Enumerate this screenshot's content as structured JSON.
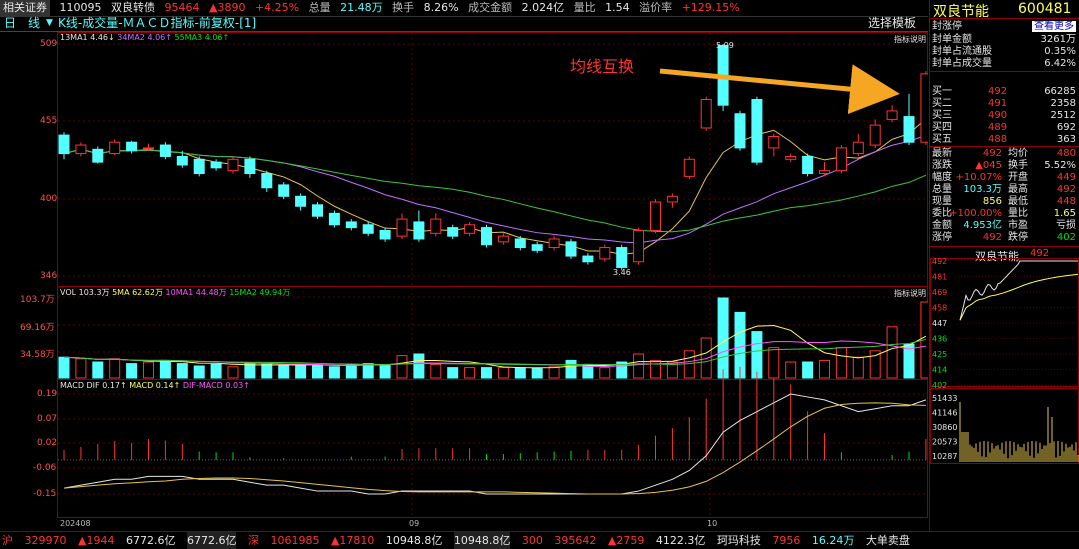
{
  "topbar": {
    "related": "相关证券",
    "code": "110095",
    "name": "双良转债",
    "price": "95464",
    "change": "▲3890",
    "pct": "+4.25%",
    "total_label": "总量",
    "total": "21.48万",
    "turnover_label": "换手",
    "turnover": "8.26%",
    "amount_label": "成交金额",
    "amount": "2.024亿",
    "volratio_label": "量比",
    "volratio": "1.54",
    "premium_label": "溢价率",
    "premium": "+129.15%"
  },
  "chartbar": {
    "period": "日　线",
    "indicator": "K线-成交量-ＭＡＣＤ指标-前复权-[1]",
    "select_template": "选择模板",
    "legend_ma": [
      "13MA1 4.46↓",
      "34MA2 4.06↑",
      "55MA3 4.06↑"
    ],
    "indicator_help": "指标说明",
    "annotation": "均线互换",
    "low_label": "3.46",
    "high_label": "5.09"
  },
  "price_axis": [
    "509",
    "455",
    "400",
    "346"
  ],
  "vol_legend": [
    "VOL 103.3万",
    "5MA 62.62万",
    "10MA1 44.48万",
    "15MA2 49.94万"
  ],
  "vol_axis": [
    "103.7万",
    "69.16万",
    "34.58万"
  ],
  "macd_legend": [
    "MACD DIF 0.17↑",
    "MACD 0.14↑",
    "DIF-MACD 0.03↑"
  ],
  "macd_axis": [
    "0.19",
    "0.07",
    "0.02",
    "-0.06",
    "-0.15"
  ],
  "date_axis": [
    "202408",
    "09",
    "10"
  ],
  "right_panel": {
    "name": "双良节能",
    "code": "600481",
    "status": "封涨停",
    "more": "查看更多",
    "seal_rows": [
      {
        "label": "封单金额",
        "value": "3261万"
      },
      {
        "label": "封单占流通股",
        "value": "0.35%"
      },
      {
        "label": "封单占成交量",
        "value": "6.42%"
      }
    ],
    "buy_rows": [
      {
        "label": "买一",
        "price": "492",
        "vol": "66285"
      },
      {
        "label": "买二",
        "price": "491",
        "vol": "2358"
      },
      {
        "label": "买三",
        "price": "490",
        "vol": "2512"
      },
      {
        "label": "买四",
        "price": "489",
        "vol": "692"
      },
      {
        "label": "买五",
        "price": "488",
        "vol": "363"
      }
    ],
    "stats": [
      {
        "l1": "最新",
        "v1": "492",
        "l2": "均价",
        "v2": "480"
      },
      {
        "l1": "涨跌",
        "v1": "▲045",
        "l2": "换手",
        "v2": "5.52%"
      },
      {
        "l1": "幅度",
        "v1": "+10.07%",
        "l2": "开盘",
        "v2": "449"
      },
      {
        "l1": "总量",
        "v1": "103.3万",
        "l2": "最高",
        "v2": "492"
      },
      {
        "l1": "现量",
        "v1": "856",
        "l2": "最低",
        "v2": "448"
      },
      {
        "l1": "委比",
        "v1": "+100.00%",
        "l2": "量比",
        "v2": "1.65"
      },
      {
        "l1": "金额",
        "v1": "4.953亿",
        "l2": "市盈",
        "v2": "亏损"
      },
      {
        "l1": "涨停",
        "v1": "492",
        "l2": "跌停",
        "v2": "402"
      }
    ],
    "mini_title": "双良节能",
    "mini_price": "492",
    "mini_axis": [
      "492",
      "481",
      "469",
      "458",
      "447",
      "436",
      "425",
      "414",
      "402"
    ],
    "mini_vol_axis": [
      "51433",
      "41146",
      "30860",
      "20573",
      "10287"
    ]
  },
  "bottom": {
    "sh_label": "沪",
    "sh_index": "329970",
    "sh_change": "▲1944",
    "sh_amount": "6772.6亿",
    "sh_amount2": "6772.6亿",
    "sz_label": "深",
    "sz_index": "1061985",
    "sz_change": "▲17810",
    "sz_amount": "10948.8亿",
    "sz_amount2": "10948.8亿",
    "cy_label": "300",
    "cy_index": "395642",
    "cy_change": "▲2759",
    "cy_amount": "4122.3亿",
    "stock_name": "珂玛科技",
    "stock_price": "7956",
    "right_amount": "16.24万",
    "big_order": "大单卖盘"
  }
}
